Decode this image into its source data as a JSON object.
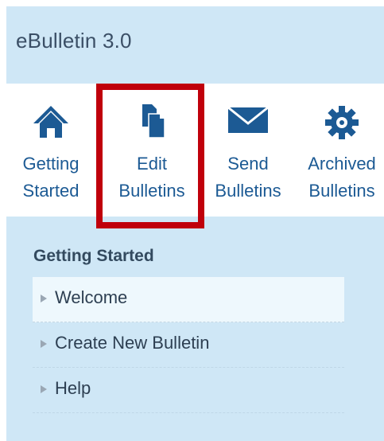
{
  "app": {
    "title": "eBulletin 3.0"
  },
  "toolbar": {
    "items": [
      {
        "line1": "Getting",
        "line2": "Started",
        "icon": "home-icon"
      },
      {
        "line1": "Edit",
        "line2": "Bulletins",
        "icon": "edit-documents-icon",
        "highlighted": true
      },
      {
        "line1": "Send",
        "line2": "Bulletins",
        "icon": "envelope-icon"
      },
      {
        "line1": "Archived",
        "line2": "Bulletins",
        "icon": "gear-icon"
      }
    ]
  },
  "sidebar": {
    "section_title": "Getting Started",
    "items": [
      {
        "label": "Welcome",
        "active": true
      },
      {
        "label": "Create New Bulletin"
      },
      {
        "label": "Help"
      }
    ]
  },
  "colors": {
    "header_bg": "#cfe7f6",
    "toolbar_bg": "#ffffff",
    "accent": "#1c5a94",
    "highlight_frame": "#c0000b"
  }
}
